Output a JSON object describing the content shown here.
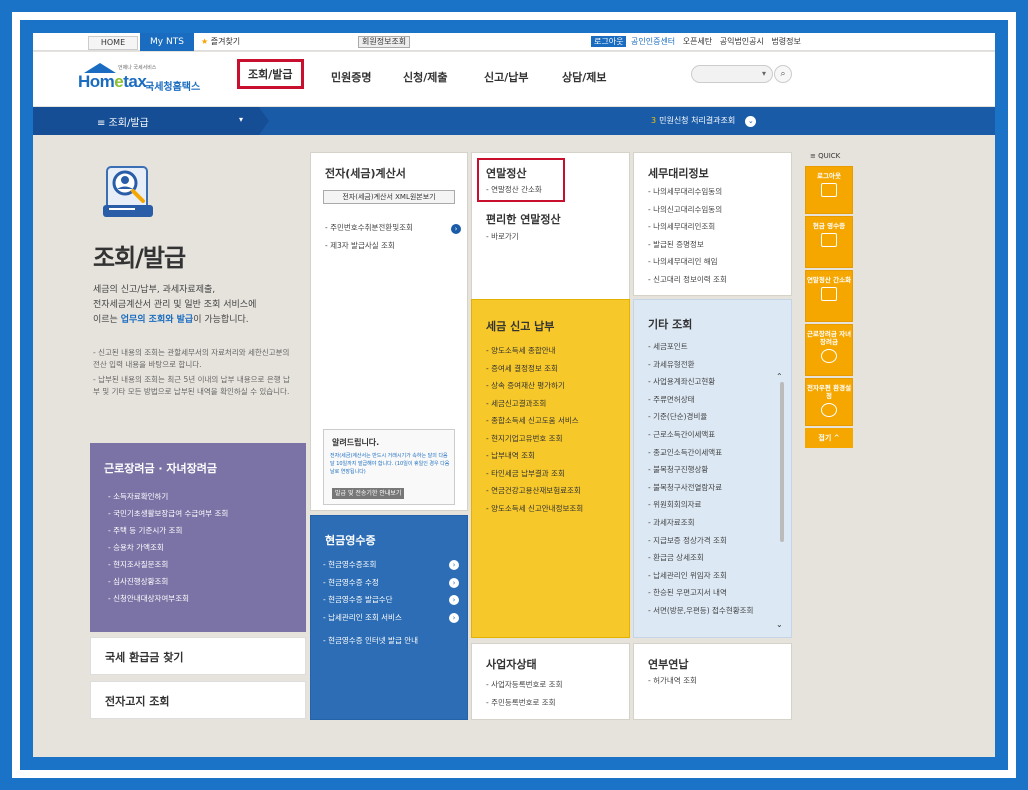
{
  "util": {
    "home": "HOME",
    "mynts": "My NTS",
    "favorites": "즐겨찾기",
    "member_info": "회원정보조회",
    "logout": "로그아웃",
    "links": [
      "공인인증센터",
      "오픈세탄",
      "공익법인공시",
      "법령정보"
    ]
  },
  "logo": {
    "text_home": "Hom",
    "text_e": "e",
    "text_tax": "tax",
    "sub": "국세청홈택스",
    "tagline": "언제나 국세서비스"
  },
  "nav": [
    "조회/발급",
    "민원증명",
    "신청/제출",
    "신고/납부",
    "상담/제보"
  ],
  "bluebar": {
    "menu": "≡  조회/발급",
    "caret": "▾",
    "right_num": "3",
    "right_text": "민원신청 처리결과조회"
  },
  "left": {
    "title": "조회/발급",
    "desc1": "세금의 신고/납부, 과세자료제출,",
    "desc2": "전자세금계산서 관리 및 일반 조회 서비스에",
    "desc3_pre": "이르는 ",
    "desc3_bold": "업무의 조회와 발급",
    "desc3_post": "이 가능합니다.",
    "notes": [
      "신고된 내용의 조회는 관할세무서의 자료처리와 세한신고분의 전산 입력 내용을 바탕으로 합니다.",
      "납부된 내용의 조회는 최근 5년 이내의 납부 내용으로 은행 납부 및 기타 모든 방법으로 납부된 내역을 확인하실 수 있습니다."
    ]
  },
  "purple": {
    "title": "근로장려금 · 자녀장려금",
    "items": [
      "소득자료확인하기",
      "국민기초생활보장급여 수급여부 조회",
      "주택 등 기준시가 조회",
      "승용차 가액조회",
      "현지조사질문조회",
      "심사진행상황조회",
      "신청안내대상자여부조회"
    ]
  },
  "refund": "국세 환급금 찾기",
  "ebill": "전자고지 조회",
  "tax_invoice": {
    "title": "전자(세금)계산서",
    "xml_btn": "전자(세금)계산서 XML원본보기",
    "items": [
      "주민번호수취분전환및조회",
      "제3자 발급사실 조회"
    ],
    "notice_title": "알려드립니다.",
    "notice_body": "전자(세금)계산서는 반드시 거래시기가 속하는 달의 다음 달 10일까지 발급해야 합니다. (10일이 휴일인 경우 다음날로 연장됩니다)",
    "notice_btn": "발급 및 전송기한 안내보기"
  },
  "yearend": {
    "title": "연말정산",
    "items": [
      "연말정산 간소화"
    ],
    "title2": "편리한 연말정산",
    "items2": [
      "바로가기"
    ]
  },
  "tax_report": {
    "title": "세금 신고 납부",
    "items": [
      "양도소득세 종합안내",
      "증여세 결정정보 조회",
      "상속 증여재산 평가하기",
      "세금신고결과조회",
      "종합소득세 신고도움 서비스",
      "현지기업고유번호 조회",
      "납부내역 조회",
      "타인세금 납부결과 조회",
      "연금건강고용산재보험료조회",
      "양도소득세 신고안내정보조회"
    ]
  },
  "agent": {
    "title": "세무대리정보",
    "items": [
      "나의세무대리수임동의",
      "나의신고대리수임동의",
      "나의세무대리인조회",
      "발급된 증명정보",
      "나의세무대리인 해임",
      "신고대리 정보이력 조회"
    ]
  },
  "other": {
    "title": "기타 조회",
    "items": [
      "세금포인트",
      "과세유형전환",
      "사업용계좌신고현황",
      "주류면허상태",
      "기준(단순)경비율",
      "근로소득간이세액표",
      "종교인소득간이세액표",
      "불복청구진행상황",
      "불복청구사전열람자료",
      "위원회회의자료",
      "과세자료조회",
      "지급보증 정상가격 조회",
      "환급금 상세조회",
      "납세관리인 위임자 조회",
      "한승된 우편고지서 내역",
      "서면(방문,우편등) 접수현황조회"
    ]
  },
  "cash": {
    "title": "현금영수증",
    "items": [
      "현금영수증조회",
      "현금영수증 수정",
      "현금영수증 발급수단",
      "납세관리인 조회 서비스",
      "현금영수증 인터넷 발급 안내"
    ]
  },
  "biz": {
    "title": "사업자상태",
    "items": [
      "사업자등록번호로 조회",
      "주민등록번호로 조회"
    ]
  },
  "annual": {
    "title": "연부연납",
    "items": [
      "허가내역 조회"
    ]
  },
  "quick": {
    "label": "≡ QUICK",
    "items": [
      "로그아웃",
      "현금 영수증",
      "연말정산 간소화",
      "근로장려금 자녀장려금",
      "전자우편 환경설정"
    ],
    "close": "접기 ^"
  }
}
